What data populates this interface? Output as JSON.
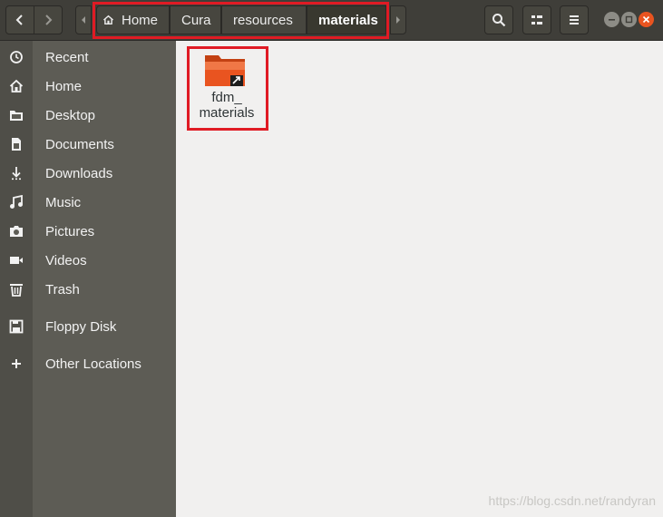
{
  "toolbar": {
    "back_icon": "chevron-left-icon",
    "forward_icon": "chevron-right-icon",
    "search_icon": "search-icon",
    "view_icon": "list-view-icon",
    "menu_icon": "hamburger-menu-icon"
  },
  "breadcrumb": {
    "items": [
      "Home",
      "Cura",
      "resources",
      "materials"
    ],
    "active_index": 3
  },
  "window_controls": [
    "minimize",
    "maximize",
    "close"
  ],
  "sidebar": {
    "items": [
      {
        "label": "Recent",
        "icon": "clock-icon"
      },
      {
        "label": "Home",
        "icon": "home-icon"
      },
      {
        "label": "Desktop",
        "icon": "folder-icon"
      },
      {
        "label": "Documents",
        "icon": "document-icon"
      },
      {
        "label": "Downloads",
        "icon": "download-icon"
      },
      {
        "label": "Music",
        "icon": "music-icon"
      },
      {
        "label": "Pictures",
        "icon": "camera-icon"
      },
      {
        "label": "Videos",
        "icon": "video-icon"
      },
      {
        "label": "Trash",
        "icon": "trash-icon"
      },
      {
        "label": "Floppy Disk",
        "icon": "floppy-icon"
      },
      {
        "label": "Other Locations",
        "icon": "plus-icon"
      }
    ]
  },
  "files": [
    {
      "name_line1": "fdm_",
      "name_line2": "materials",
      "type": "folder-symlink"
    }
  ],
  "colors": {
    "highlight": "#e01b24",
    "folder": "#e95420",
    "header_bg": "#3f3e39",
    "sidebar_bg": "#5d5c55"
  },
  "watermark": "https://blog.csdn.net/randyran"
}
